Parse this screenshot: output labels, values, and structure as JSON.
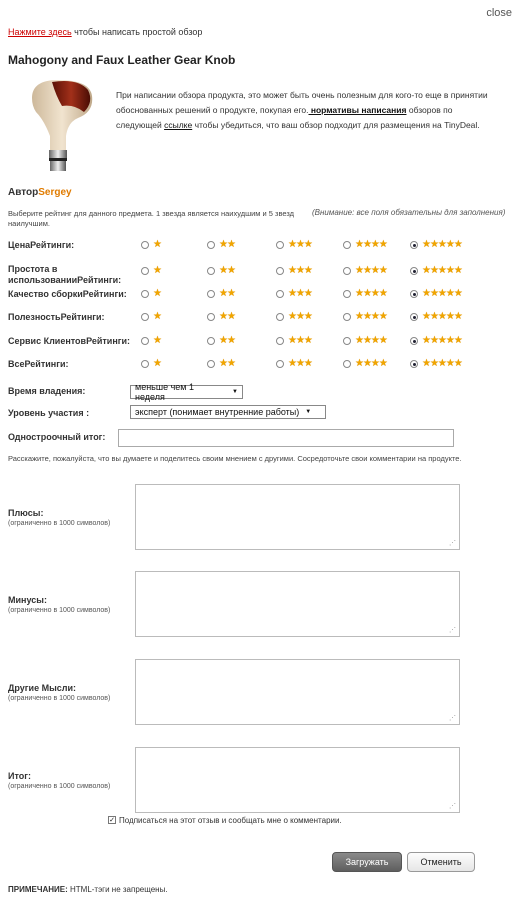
{
  "header": {
    "close_label": "close",
    "write_link": "Нажмите здесь",
    "write_text": " чтобы написать простой обзор"
  },
  "product": {
    "title": "Mahogony and Faux Leather Gear Knob",
    "intro_1": "При написании обзора продукта, это может быть очень полезным для кого-то еще в принятии обоснованных решений о продукте, покупая его.",
    "intro_link": " нормативы написания",
    "intro_2": " обзоров по следующей ",
    "intro_link2": "ссылке",
    "intro_3": " чтобы убедиться, что ваш обзор подходит для размещения на TinyDeal."
  },
  "author": {
    "label": "Автор",
    "name": "Sergey"
  },
  "rating_hint": "Выберите рейтинг для данного предмета. 1 звезда является наихудшим и 5 звезд наилучшим.",
  "required_note": "(Внимание: все поля обязательны для заполнения)",
  "star_glyphs": [
    "★",
    "★★",
    "★★★",
    "★★★★",
    "★★★★★"
  ],
  "ratings": [
    {
      "label": "ЦенаРейтинги:",
      "selected": 5
    },
    {
      "label": "Простота в использованииРейтинги:",
      "selected": 5
    },
    {
      "label": "Качество сборкиРейтинги:",
      "selected": 5
    },
    {
      "label": "ПолезностьРейтинги:",
      "selected": 5
    },
    {
      "label": "Сервис КлиентовРейтинги:",
      "selected": 5
    },
    {
      "label": "ВсеРейтинги:",
      "selected": 5
    }
  ],
  "fields": {
    "ownership_label": "Время владения:",
    "ownership_value": "меньше чем 1 неделя",
    "level_label": "Уровень участия :",
    "level_value": "эксперт (понимает внутренние работы)",
    "oneline_label": "Одностроочный итог:",
    "oneline_value": ""
  },
  "instructions": "Расскажите, пожалуйста, что вы думаете и поделитесь своим мнением с другими. Сосредоточьте свои комментарии на продукте.",
  "textareas": [
    {
      "label": "Плюсы:",
      "sub": "(ограниченно в 1000 символов)"
    },
    {
      "label": "Минусы:",
      "sub": "(ограниченно в 1000 символов)"
    },
    {
      "label": "Другие Мысли:",
      "sub": "(ограниченно в 1000 символов)"
    },
    {
      "label": "Итог:",
      "sub": "(ограниченно в 1000 символов)"
    }
  ],
  "subscribe": {
    "checked": true,
    "label": "Подписаться на этот отзыв и сообщать мне о комментарии."
  },
  "buttons": {
    "submit": "Загружать",
    "cancel": "Отменить"
  },
  "footnote": {
    "bold": "ПРИМЕЧАНИЕ:",
    "text": " HTML-тэги не запрещены."
  },
  "colors": {
    "star": "#f0a500",
    "author_name": "#e07b00",
    "link_red": "#cc0000"
  }
}
